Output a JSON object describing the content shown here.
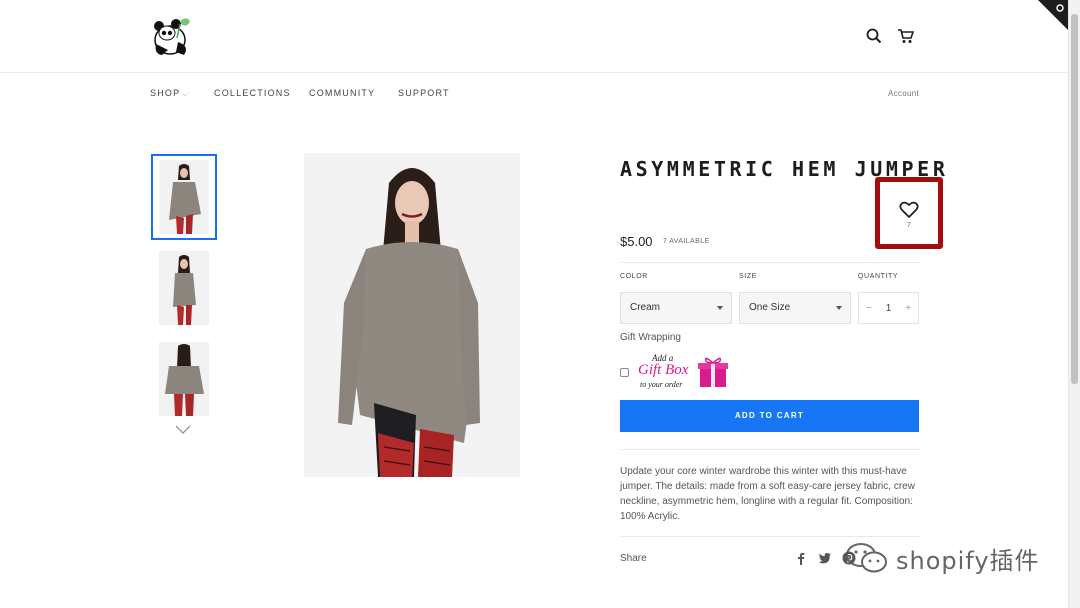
{
  "nav": {
    "items": [
      {
        "label": "SHOP",
        "has_chevron": true
      },
      {
        "label": "COLLECTIONS"
      },
      {
        "label": "COMMUNITY"
      },
      {
        "label": "SUPPORT"
      }
    ],
    "account": "Account"
  },
  "product": {
    "title": "ASYMMETRIC HEM JUMPER",
    "price": "$5.00",
    "stock": "7 AVAILABLE",
    "wishlist_count": "7",
    "color_label": "COLOR",
    "color_value": "Cream",
    "size_label": "SIZE",
    "size_value": "One Size",
    "quantity_label": "QUANTITY",
    "quantity": "1",
    "qty_minus": "−",
    "qty_plus": "+",
    "gift_wrapping_label": "Gift Wrapping",
    "gift_box_line1": "Add a",
    "gift_box_line2": "Gift Box",
    "gift_box_line3": "to your order",
    "add_to_cart": "ADD TO CART",
    "description": "Update your core winter wardrobe this winter with this must-have jumper. The details: made from a soft easy-care jersey fabric, crew neckline, asymmetric hem, longline with a regular fit. Composition: 100% Acrylic.",
    "share_label": "Share"
  },
  "watermark": {
    "text": "shopify插件"
  },
  "colors": {
    "accent": "#1776f5",
    "highlight": "#a30d0d",
    "gift_pink": "#d81b8d"
  },
  "icons": [
    "panda-logo",
    "search-icon",
    "cart-icon",
    "heart-icon",
    "chevron-down-icon",
    "gift-icon",
    "facebook-icon",
    "twitter-icon",
    "pinterest-icon",
    "wechat-icon"
  ]
}
